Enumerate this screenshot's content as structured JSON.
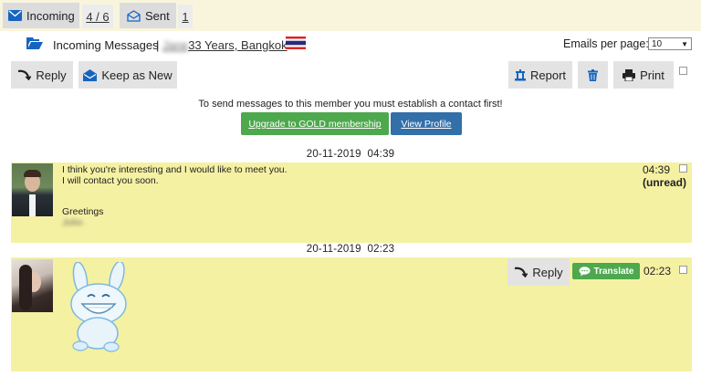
{
  "tabs": {
    "incoming_label": "Incoming",
    "incoming_count": "4 / 6",
    "sent_label": "Sent",
    "sent_count": "1"
  },
  "header": {
    "section_title": "Incoming Messages",
    "separator": "|",
    "blurred_name": "Jane",
    "member_info": " 33 Years, Bangkok",
    "emails_per_page_label": "Emails per page:",
    "emails_per_page_value": "10"
  },
  "toolbar": {
    "reply_label": "Reply",
    "keep_as_new_label": "Keep as New",
    "report_label": "Report",
    "print_label": "Print"
  },
  "notice": {
    "text": "To send messages to this member you must establish a contact first!",
    "upgrade_label": "Upgrade to GOLD membership",
    "view_profile_label": "View Profile"
  },
  "messages": [
    {
      "date": "20-11-2019  04:39",
      "time": "04:39",
      "status": "(unread)",
      "line1": "I think you're interesting and I would like to meet you.",
      "line2": "I will contact you soon.",
      "greeting": "Greetings",
      "signature": "John"
    },
    {
      "date": "20-11-2019  02:23",
      "time": "02:23",
      "reply_label": "Reply",
      "translate_label": "Translate"
    }
  ],
  "colors": {
    "message_bg": "#f5f1a3",
    "top_bar": "#f8f5dc",
    "upgrade_green": "#4ea84e",
    "profile_blue": "#336fa8",
    "icon_blue": "#1565c0"
  }
}
